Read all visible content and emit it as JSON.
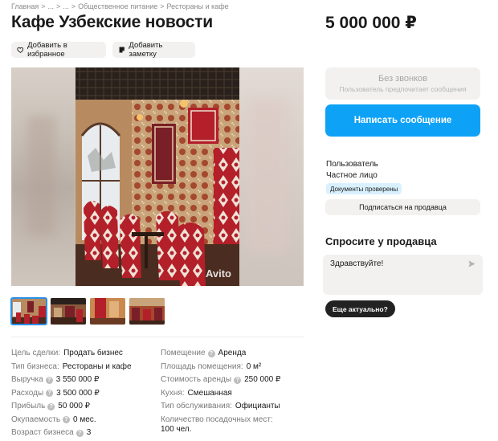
{
  "breadcrumb": [
    "Главная",
    "...",
    "...",
    "Общественное питание",
    "Рестораны и кафе"
  ],
  "listing": {
    "title": "Кафе Узбекские новости",
    "price": "5 000 000 ₽"
  },
  "actions": {
    "favorite_label": "Добавить в избранное",
    "note_label": "Добавить заметку"
  },
  "gallery": {
    "watermark": "Avito",
    "thumbnail_count": 4,
    "active_thumbnail": 1
  },
  "params_left": [
    {
      "label": "Цель сделки:",
      "value": "Продать бизнес",
      "help": false
    },
    {
      "label": "Тип бизнеса:",
      "value": "Рестораны и кафе",
      "help": false
    },
    {
      "label": "Выручка",
      "value": "3 550 000 ₽",
      "help": true
    },
    {
      "label": "Расходы",
      "value": "3 500 000 ₽",
      "help": true
    },
    {
      "label": "Прибыль",
      "value": "50 000 ₽",
      "help": true
    },
    {
      "label": "Окупаемость",
      "value": "0 мес.",
      "help": true
    },
    {
      "label": "Возраст бизнеса",
      "value": "3",
      "help": true
    }
  ],
  "params_right": [
    {
      "label": "Помещение",
      "value": "Аренда",
      "help": true
    },
    {
      "label": "Площадь помещения:",
      "value": "0 м²",
      "help": false
    },
    {
      "label": "Стоимость аренды",
      "value": "250 000 ₽",
      "help": true
    },
    {
      "label": "Кухня:",
      "value": "Смешанная",
      "help": false
    },
    {
      "label": "Тип обслуживания:",
      "value": "Официанты",
      "help": false
    },
    {
      "label": "Количество посадочных мест:",
      "value": "100 чел.",
      "help": false
    }
  ],
  "contact": {
    "no_calls_title": "Без звонков",
    "no_calls_subtitle": "Пользователь предпочитает сообщения",
    "message_button": "Написать сообщение"
  },
  "seller": {
    "name": "Пользователь",
    "type": "Частное лицо",
    "verified_badge": "Документы проверены",
    "subscribe_button": "Подписаться на продавца"
  },
  "ask": {
    "title": "Спросите у продавца",
    "message_value": "Здравствуйте!",
    "quick_reply": "Еще актуально?"
  },
  "colors": {
    "accent": "#0ea2f7",
    "chip_bg": "#f2f1f0",
    "verified_bg": "#d9f1ff"
  }
}
